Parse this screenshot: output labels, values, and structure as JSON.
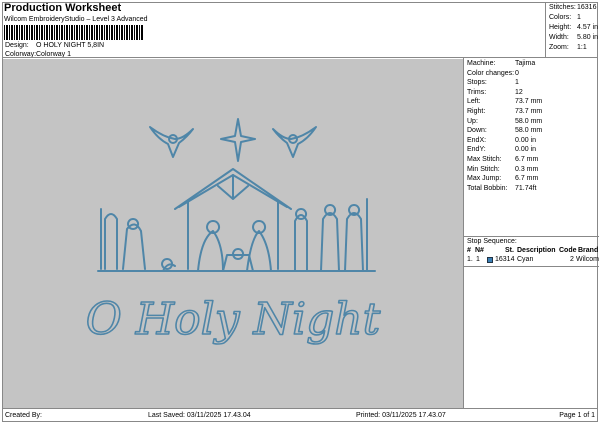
{
  "header": {
    "title": "Production Worksheet",
    "software": "Wilcom EmbroideryStudio – Level 3 Advanced",
    "design_label": "Design:",
    "design_value": "O HOLY NIGHT 5,8IN",
    "colorway_label": "Colorway:",
    "colorway_value": "Colorway 1"
  },
  "stats": [
    {
      "label": "Stitches:",
      "value": "16316"
    },
    {
      "label": "Colors:",
      "value": "1"
    },
    {
      "label": "Height:",
      "value": "4.57 in"
    },
    {
      "label": "Width:",
      "value": "5.80 in"
    },
    {
      "label": "Zoom:",
      "value": "1:1"
    }
  ],
  "details": [
    {
      "label": "Machine:",
      "value": "Tajima"
    },
    {
      "label": "Color changes:",
      "value": "0"
    },
    {
      "label": "Stops:",
      "value": "1"
    },
    {
      "label": "Trims:",
      "value": "12"
    },
    {
      "label": "Left:",
      "value": "73.7 mm"
    },
    {
      "label": "Right:",
      "value": "73.7 mm"
    },
    {
      "label": "Up:",
      "value": "58.0 mm"
    },
    {
      "label": "Down:",
      "value": "58.0 mm"
    },
    {
      "label": "EndX:",
      "value": "0.00 in"
    },
    {
      "label": "EndY:",
      "value": "0.00 in"
    },
    {
      "label": "Max Stitch:",
      "value": "6.7 mm"
    },
    {
      "label": "Min Stitch:",
      "value": "0.3 mm"
    },
    {
      "label": "Max Jump:",
      "value": "6.7 mm"
    },
    {
      "label": "Total Bobbin:",
      "value": "71.74ft"
    }
  ],
  "stop_sequence": {
    "title": "Stop Sequence:",
    "columns": [
      "#",
      "N#",
      "St.",
      "Description",
      "Code",
      "Brand"
    ],
    "rows": [
      {
        "num": "1.",
        "n": "1",
        "stitches": "16314",
        "description": "Cyan",
        "code": "2",
        "brand": "Wilcom",
        "color": "#3a7fb5"
      }
    ]
  },
  "design": {
    "text": "O Holy Night",
    "thread_color": "#4f86a8"
  },
  "footer": {
    "created_by": "Created By:",
    "last_saved": "Last Saved: 03/11/2025 17.43.04",
    "printed": "Printed: 03/11/2025 17.43.07",
    "page": "Page 1 of 1"
  }
}
